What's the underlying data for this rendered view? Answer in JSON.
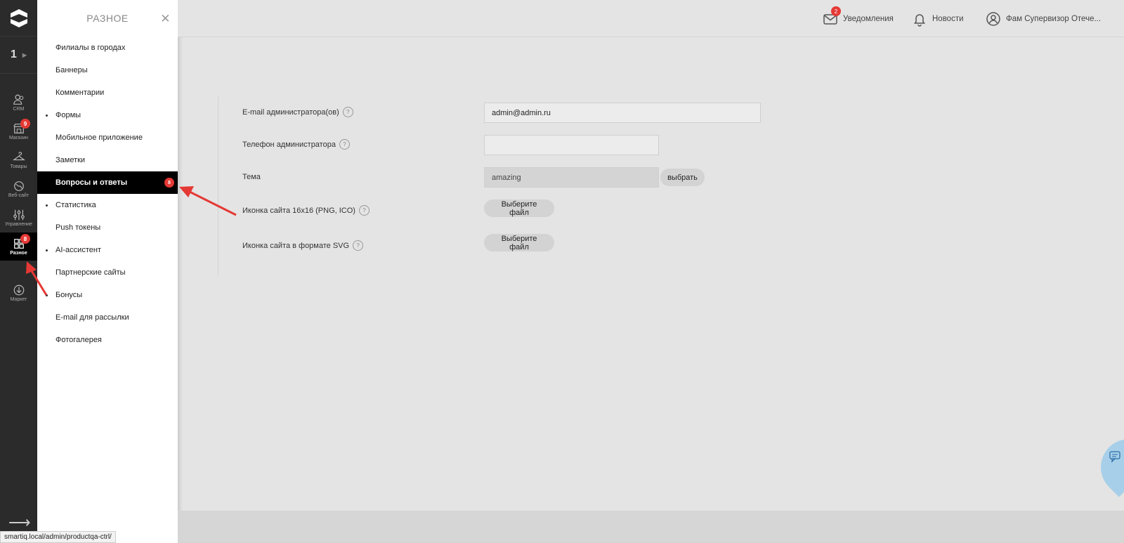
{
  "rail": {
    "project_number": "1",
    "items": [
      {
        "label": "CRM",
        "icon": "users-icon"
      },
      {
        "label": "Магазин",
        "icon": "shop-icon",
        "badge": "9"
      },
      {
        "label": "Товары",
        "icon": "hanger-icon"
      },
      {
        "label": "Веб-сайт",
        "icon": "globe-icon"
      },
      {
        "label": "Управление",
        "icon": "sliders-icon"
      },
      {
        "label": "Разное",
        "icon": "grid-icon",
        "badge": "8"
      },
      {
        "label": "Маркет",
        "icon": "download-icon"
      }
    ]
  },
  "submenu": {
    "title": "РАЗНОЕ",
    "items": [
      {
        "label": "Филиалы в городах"
      },
      {
        "label": "Баннеры"
      },
      {
        "label": "Комментарии"
      },
      {
        "label": "Формы"
      },
      {
        "label": "Мобильное приложение"
      },
      {
        "label": "Заметки"
      },
      {
        "label": "Вопросы и ответы",
        "badge": "8"
      },
      {
        "label": "Статистика"
      },
      {
        "label": "Push токены"
      },
      {
        "label": "AI-ассистент"
      },
      {
        "label": "Партнерские сайты"
      },
      {
        "label": "Бонусы"
      },
      {
        "label": "E-mail для рассылки"
      },
      {
        "label": "Фотогалерея"
      }
    ]
  },
  "topbar": {
    "notifications_label": "Уведомления",
    "notifications_badge": "2",
    "news_label": "Новости",
    "user_label": "Фам Супервизор Отече..."
  },
  "form": {
    "admin_email_label": "E-mail администратора(ов)",
    "admin_email_value": "admin@admin.ru",
    "admin_phone_label": "Телефон администратора",
    "admin_phone_value": "",
    "theme_label": "Тема",
    "theme_value": "amazing",
    "theme_choose_button": "выбрать",
    "favicon_label": "Иконка сайта 16x16 (PNG, ICO)",
    "favicon_button": "Выберите файл",
    "svg_icon_label": "Иконка сайта в формате SVG",
    "svg_icon_button": "Выберите файл",
    "help_symbol": "?"
  },
  "statusbar": {
    "url": "smartiq.local/admin/productqa-ctrl/"
  },
  "colors": {
    "accent_badge": "#e53935",
    "annotation_arrow": "#e53935",
    "rail_bg": "#2b2b2b"
  }
}
